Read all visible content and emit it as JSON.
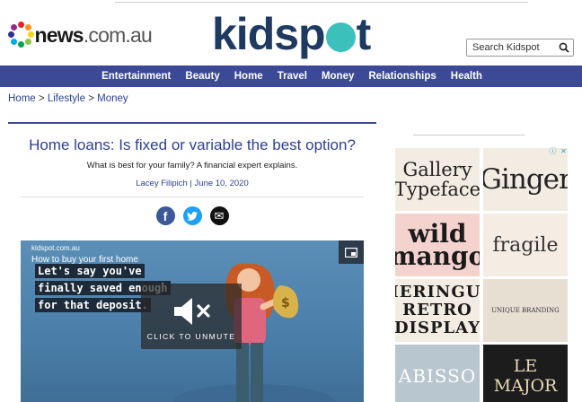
{
  "header": {
    "news_logo": {
      "bold": "news",
      "light": ".com.au"
    },
    "site_logo": {
      "before": "kidsp",
      "after": "t"
    },
    "search": {
      "placeholder": "Search Kidspot"
    }
  },
  "nav": {
    "items": [
      "Entertainment",
      "Beauty",
      "Home",
      "Travel",
      "Money",
      "Relationships",
      "Health"
    ]
  },
  "breadcrumb": {
    "items": [
      "Home",
      "Lifestyle",
      "Money"
    ],
    "separator": ">"
  },
  "article": {
    "title": "Home loans: Is fixed or variable the best option?",
    "subtitle": "What is best for your family? A financial expert explains.",
    "byline": "Lacey Filipich | June 10, 2020",
    "share": [
      {
        "icon": "facebook-icon",
        "glyph": "f",
        "color": "#3b5998"
      },
      {
        "icon": "twitter-icon",
        "glyph": "t",
        "color": "#1da1f2"
      },
      {
        "icon": "email-icon",
        "glyph": "✉",
        "color": "#111111"
      }
    ]
  },
  "video": {
    "source": "kidspot.com.au",
    "title": "How to buy your first home",
    "captions": [
      "Let's say you've",
      "finally saved enough",
      "for that deposit."
    ],
    "unmute_label": "CLICK TO UNMUTE"
  },
  "ad": {
    "tiles": [
      "Gallery Typeface",
      "Ginger",
      "wild mango",
      "fragile",
      "MERINGUE RETRO DISPLAY",
      "UNIQUE BRANDING",
      "ABISSO",
      "LE MAJOR"
    ]
  },
  "colors": {
    "nav_bg": "#3b4997",
    "brand_navy": "#1f3a61",
    "brand_teal": "#3cc0bb",
    "link": "#2f3f94"
  }
}
